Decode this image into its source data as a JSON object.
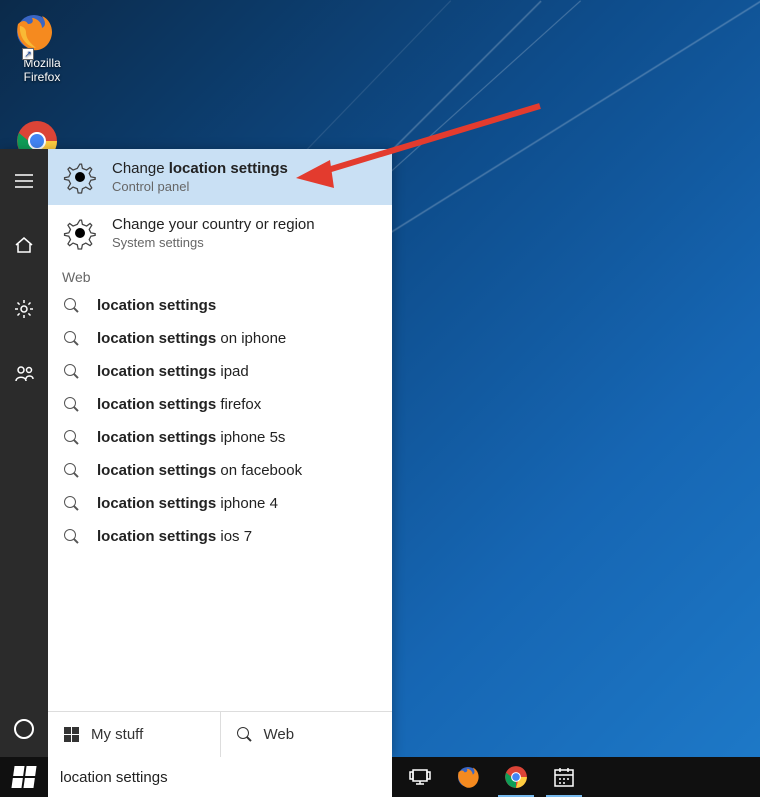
{
  "desktop": {
    "icons": [
      {
        "name": "firefox-shortcut",
        "label": "Mozilla\nFirefox"
      }
    ]
  },
  "arrow": {
    "color": "#e33b2e"
  },
  "cortana": {
    "results": [
      {
        "title_prefix": "Change ",
        "title_bold": "location settings",
        "title_suffix": "",
        "subtitle": "Control panel",
        "selected": true
      },
      {
        "title_prefix": "",
        "title_bold": "",
        "title_suffix": "Change your country or region",
        "subtitle": "System settings",
        "selected": false
      }
    ],
    "web_header": "Web",
    "web_items": [
      {
        "bold": "location settings",
        "rest": ""
      },
      {
        "bold": "location settings",
        "rest": " on iphone"
      },
      {
        "bold": "location settings",
        "rest": " ipad"
      },
      {
        "bold": "location settings",
        "rest": " firefox"
      },
      {
        "bold": "location settings",
        "rest": " iphone 5s"
      },
      {
        "bold": "location settings",
        "rest": " on facebook"
      },
      {
        "bold": "location settings",
        "rest": " iphone 4"
      },
      {
        "bold": "location settings",
        "rest": " ios 7"
      }
    ],
    "tabs": {
      "mystuff": "My stuff",
      "web": "Web"
    }
  },
  "taskbar": {
    "search_value": "location settings",
    "items": [
      {
        "name": "task-view-button"
      },
      {
        "name": "firefox-task-icon"
      },
      {
        "name": "chrome-task-icon"
      },
      {
        "name": "calendar-task-icon"
      }
    ]
  }
}
